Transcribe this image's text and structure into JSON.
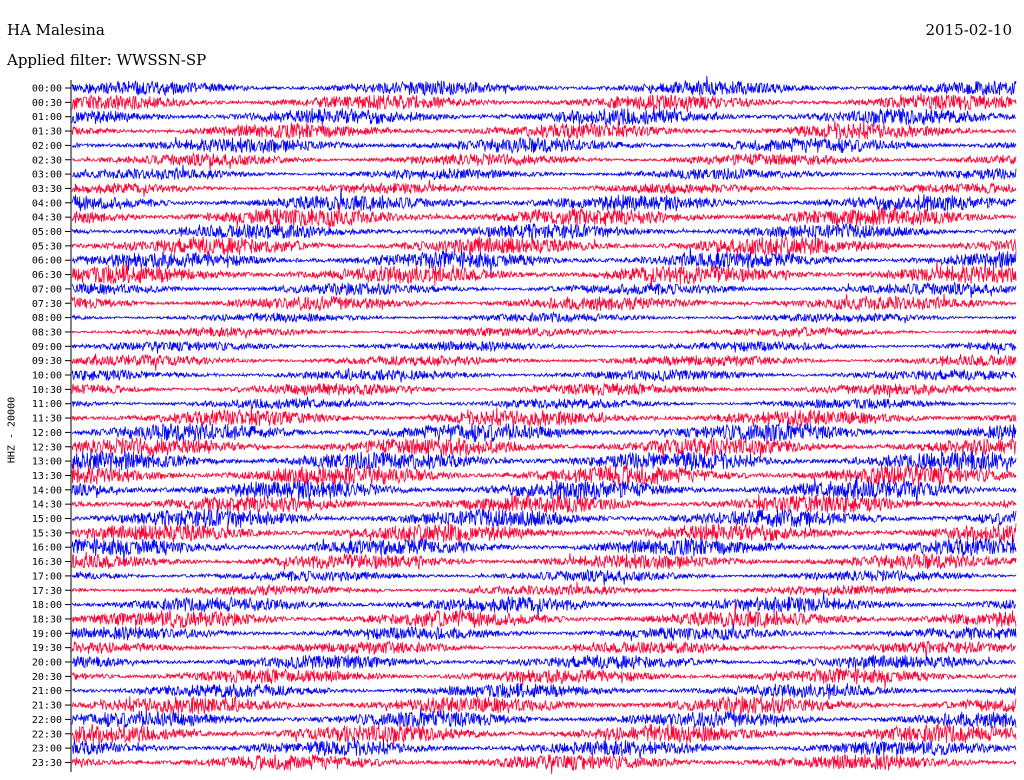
{
  "header": {
    "station": "HA Malesina",
    "date": "2015-02-10",
    "filter": "Applied filter: WWSSN-SP"
  },
  "chart_data": {
    "type": "line",
    "title": "HA Malesina",
    "ylabel": "HHZ - 20000",
    "trace_colors": [
      "#0000ff",
      "#ff0033"
    ],
    "row_labels": [
      "00:00",
      "00:30",
      "01:00",
      "01:30",
      "02:00",
      "02:30",
      "03:00",
      "03:30",
      "04:00",
      "04:30",
      "05:00",
      "05:30",
      "06:00",
      "06:30",
      "07:00",
      "07:30",
      "08:00",
      "08:30",
      "09:00",
      "09:30",
      "10:00",
      "10:30",
      "11:00",
      "11:30",
      "12:00",
      "12:30",
      "13:00",
      "13:30",
      "14:00",
      "14:30",
      "15:00",
      "15:30",
      "16:00",
      "16:30",
      "17:00",
      "17:30",
      "18:00",
      "18:30",
      "19:00",
      "19:30",
      "20:00",
      "20:30",
      "21:00",
      "21:30",
      "22:00",
      "22:30",
      "23:00",
      "23:30"
    ],
    "row_amplitude": [
      0.7,
      0.75,
      0.8,
      0.75,
      0.75,
      0.6,
      0.55,
      0.5,
      0.8,
      0.95,
      0.75,
      0.9,
      0.85,
      0.9,
      0.6,
      0.7,
      0.45,
      0.45,
      0.5,
      0.55,
      0.55,
      0.6,
      0.5,
      0.8,
      0.9,
      0.9,
      0.95,
      1.0,
      0.95,
      0.9,
      0.9,
      0.9,
      0.85,
      0.75,
      0.55,
      0.5,
      0.75,
      0.85,
      0.65,
      0.6,
      0.7,
      0.75,
      0.7,
      0.85,
      0.8,
      0.9,
      0.75,
      0.8
    ]
  }
}
